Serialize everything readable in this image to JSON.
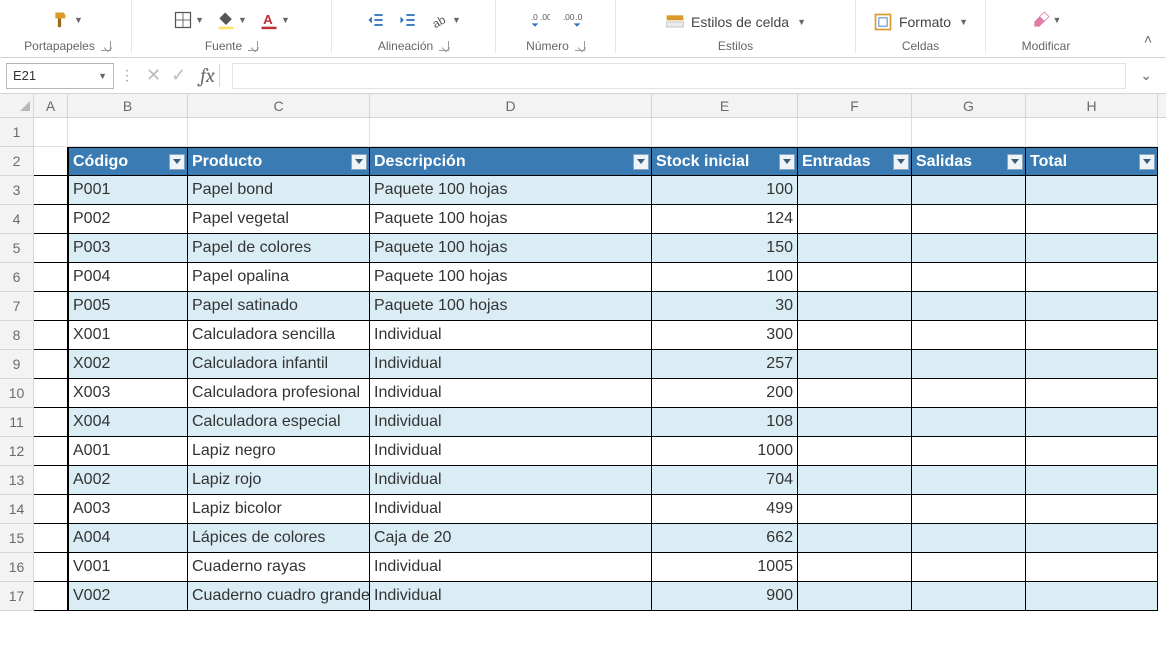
{
  "ribbon": {
    "groups": {
      "portapapeles": "Portapapeles",
      "fuente": "Fuente",
      "alineacion": "Alineación",
      "numero": "Número",
      "estilos": "Estilos",
      "celdas": "Celdas",
      "modificar": "Modificar"
    },
    "estilos_de_celda": "Estilos de celda",
    "formato": "Formato"
  },
  "namebox": {
    "value": "E21"
  },
  "fx": {
    "label": "fx",
    "value": ""
  },
  "columns": [
    "A",
    "B",
    "C",
    "D",
    "E",
    "F",
    "G",
    "H"
  ],
  "row_numbers": [
    1,
    2,
    3,
    4,
    5,
    6,
    7,
    8,
    9,
    10,
    11,
    12,
    13,
    14,
    15,
    16,
    17
  ],
  "table": {
    "headers": {
      "codigo": "Código",
      "producto": "Producto",
      "descripcion": "Descripción",
      "stock_inicial": "Stock inicial",
      "entradas": "Entradas",
      "salidas": "Salidas",
      "total": "Total"
    },
    "rows": [
      {
        "codigo": "P001",
        "producto": "Papel bond",
        "descripcion": "Paquete 100 hojas",
        "stock": "100",
        "entradas": "",
        "salidas": "",
        "total": ""
      },
      {
        "codigo": "P002",
        "producto": "Papel vegetal",
        "descripcion": "Paquete 100 hojas",
        "stock": "124",
        "entradas": "",
        "salidas": "",
        "total": ""
      },
      {
        "codigo": "P003",
        "producto": "Papel de colores",
        "descripcion": "Paquete 100 hojas",
        "stock": "150",
        "entradas": "",
        "salidas": "",
        "total": ""
      },
      {
        "codigo": "P004",
        "producto": "Papel opalina",
        "descripcion": "Paquete 100 hojas",
        "stock": "100",
        "entradas": "",
        "salidas": "",
        "total": ""
      },
      {
        "codigo": "P005",
        "producto": "Papel satinado",
        "descripcion": "Paquete 100 hojas",
        "stock": "30",
        "entradas": "",
        "salidas": "",
        "total": ""
      },
      {
        "codigo": "X001",
        "producto": "Calculadora sencilla",
        "descripcion": "Individual",
        "stock": "300",
        "entradas": "",
        "salidas": "",
        "total": ""
      },
      {
        "codigo": "X002",
        "producto": "Calculadora infantil",
        "descripcion": "Individual",
        "stock": "257",
        "entradas": "",
        "salidas": "",
        "total": ""
      },
      {
        "codigo": "X003",
        "producto": "Calculadora profesional",
        "descripcion": "Individual",
        "stock": "200",
        "entradas": "",
        "salidas": "",
        "total": ""
      },
      {
        "codigo": "X004",
        "producto": "Calculadora especial",
        "descripcion": "Individual",
        "stock": "108",
        "entradas": "",
        "salidas": "",
        "total": ""
      },
      {
        "codigo": "A001",
        "producto": "Lapiz negro",
        "descripcion": "Individual",
        "stock": "1000",
        "entradas": "",
        "salidas": "",
        "total": ""
      },
      {
        "codigo": "A002",
        "producto": "Lapiz rojo",
        "descripcion": "Individual",
        "stock": "704",
        "entradas": "",
        "salidas": "",
        "total": ""
      },
      {
        "codigo": "A003",
        "producto": "Lapiz bicolor",
        "descripcion": "Individual",
        "stock": "499",
        "entradas": "",
        "salidas": "",
        "total": ""
      },
      {
        "codigo": "A004",
        "producto": "Lápices de colores",
        "descripcion": "Caja de 20",
        "stock": "662",
        "entradas": "",
        "salidas": "",
        "total": ""
      },
      {
        "codigo": "V001",
        "producto": "Cuaderno rayas",
        "descripcion": "Individual",
        "stock": "1005",
        "entradas": "",
        "salidas": "",
        "total": ""
      },
      {
        "codigo": "V002",
        "producto": "Cuaderno cuadro grande",
        "descripcion": "Individual",
        "stock": "900",
        "entradas": "",
        "salidas": "",
        "total": ""
      }
    ]
  }
}
